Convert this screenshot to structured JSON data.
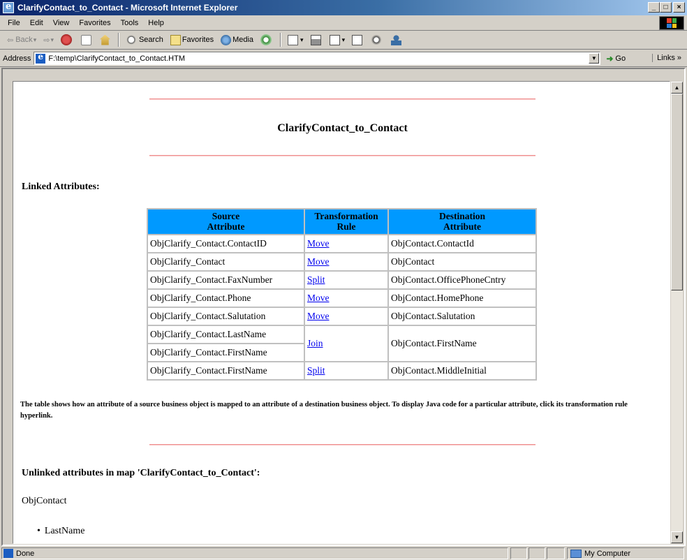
{
  "window": {
    "title": "ClarifyContact_to_Contact - Microsoft Internet Explorer",
    "minimize": "_",
    "maximize": "□",
    "close": "×"
  },
  "menu": [
    "File",
    "Edit",
    "View",
    "Favorites",
    "Tools",
    "Help"
  ],
  "toolbar": {
    "back": "Back",
    "search": "Search",
    "favorites": "Favorites",
    "media": "Media"
  },
  "address": {
    "label": "Address",
    "value": "F:\\temp\\ClarifyContact_to_Contact.HTM",
    "go": "Go",
    "links": "Links »"
  },
  "page": {
    "title": "ClarifyContact_to_Contact",
    "linked_heading": "Linked Attributes:",
    "columns": [
      "Source Attribute",
      "Transformation Rule",
      "Destination Attribute"
    ],
    "rows": [
      {
        "source": "ObjClarify_Contact.ContactID",
        "rule": "Move",
        "dest": "ObjContact.ContactId"
      },
      {
        "source": "ObjClarify_Contact",
        "rule": "Move",
        "dest": "ObjContact"
      },
      {
        "source": "ObjClarify_Contact.FaxNumber",
        "rule": "Split",
        "dest": "ObjContact.OfficePhoneCntry"
      },
      {
        "source": "ObjClarify_Contact.Phone",
        "rule": "Move",
        "dest": "ObjContact.HomePhone"
      },
      {
        "source": "ObjClarify_Contact.Salutation",
        "rule": "Move",
        "dest": "ObjContact.Salutation"
      },
      {
        "source": "ObjClarify_Contact.LastName",
        "rule": "Join",
        "dest": "ObjContact.FirstName"
      },
      {
        "source": "ObjClarify_Contact.FirstName"
      },
      {
        "source": "ObjClarify_Contact.FirstName",
        "rule": "Split",
        "dest": "ObjContact.MiddleInitial"
      }
    ],
    "note": "The table shows how an attribute of a source business object is mapped to an attribute of a destination business object. To display Java code for a particular attribute, click its transformation rule hyperlink.",
    "unlinked_heading": "Unlinked attributes in map 'ClarifyContact_to_Contact':",
    "unlinked_object": "ObjContact",
    "unlinked_items": [
      "LastName"
    ]
  },
  "status": {
    "text": "Done",
    "zone": "My Computer"
  },
  "colors": {
    "header_bg": "#0099ff",
    "rule_line": "#f09090",
    "link": "#0000ee"
  }
}
